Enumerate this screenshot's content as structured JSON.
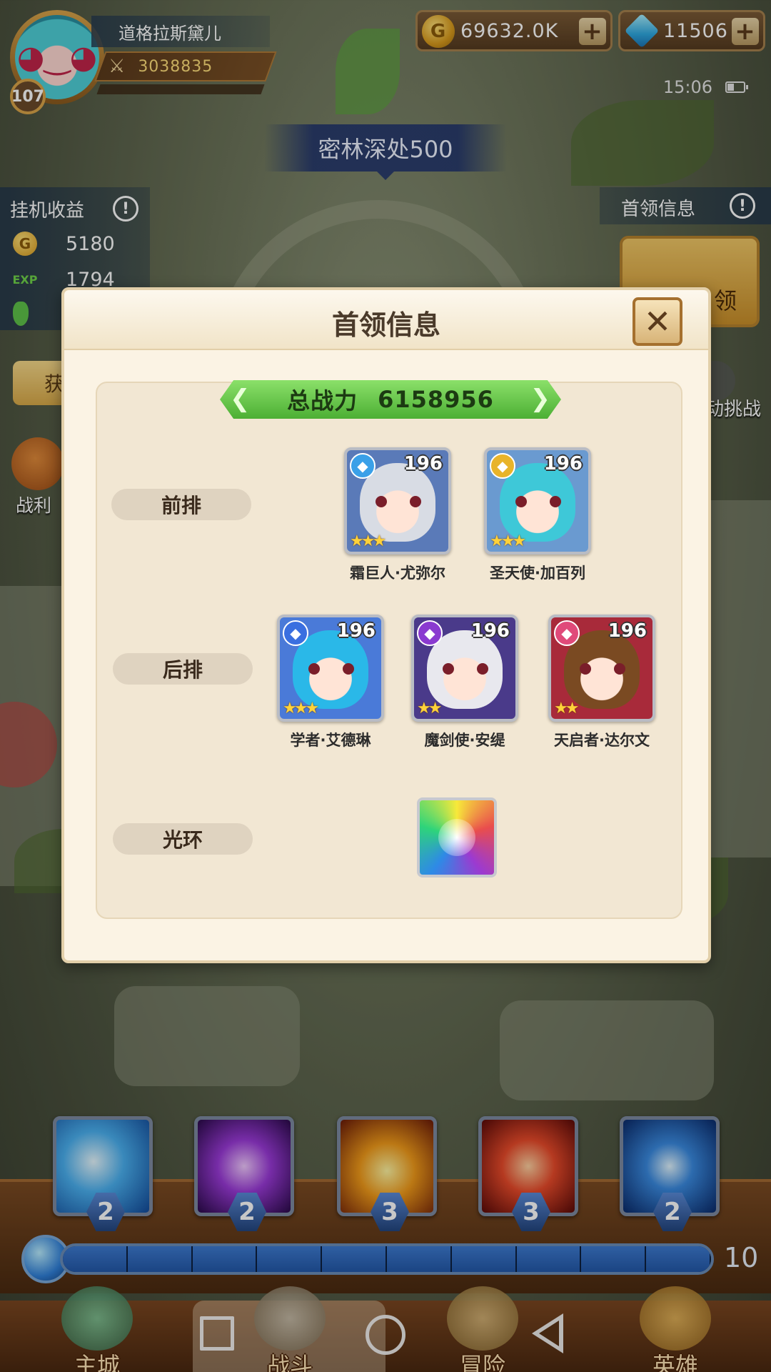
{
  "player": {
    "name": "道格拉斯黛儿",
    "power": "3038835",
    "level": "107"
  },
  "currency": {
    "gold": "69632.0K",
    "gems": "11506",
    "plus": "+"
  },
  "status": {
    "time": "15:06",
    "battery_level": 0.4
  },
  "stage": {
    "title": "密林深处500"
  },
  "idle": {
    "title": "挂机收益",
    "gold_value": "5180",
    "exp_label": "EXP",
    "exp_value": "1794",
    "claim_button_partial": "获",
    "loot_label_partial": "战利"
  },
  "boss_panel": {
    "title": "首领信息",
    "button_partial": "领",
    "auto_challenge_partial": "动挑战"
  },
  "modal": {
    "title": "首领信息",
    "close": "✕",
    "power_label": "总战力",
    "power_value": "6158956",
    "front_row_label": "前排",
    "back_row_label": "后排",
    "aura_label": "光环",
    "front_row": [
      {
        "name": "霜巨人·尤弥尔",
        "level": "196",
        "stars": 3,
        "class_color": "#3aa0e8"
      },
      {
        "name": "圣天使·加百列",
        "level": "196",
        "stars": 3,
        "class_color": "#e8b42a"
      }
    ],
    "back_row": [
      {
        "name": "学者·艾德琳",
        "level": "196",
        "stars": 3,
        "class_color": "#3a6fe0"
      },
      {
        "name": "魔剑使·安缇",
        "level": "196",
        "stars": 2,
        "class_color": "#8a3ad0"
      },
      {
        "name": "天启者·达尔文",
        "level": "196",
        "stars": 2,
        "class_color": "#e04a7a"
      }
    ]
  },
  "skills": [
    {
      "name": "ice-spear-skill-icon",
      "count": "2"
    },
    {
      "name": "shadow-sword-skill-icon",
      "count": "2"
    },
    {
      "name": "fire-burst-skill-icon",
      "count": "3"
    },
    {
      "name": "flame-slash-skill-icon",
      "count": "3"
    },
    {
      "name": "whirlpool-skill-icon",
      "count": "2"
    }
  ],
  "energy": {
    "value": "10"
  },
  "nav": [
    {
      "label": "主城"
    },
    {
      "label": "战斗"
    },
    {
      "label": "冒险"
    },
    {
      "label": "英雄"
    }
  ]
}
